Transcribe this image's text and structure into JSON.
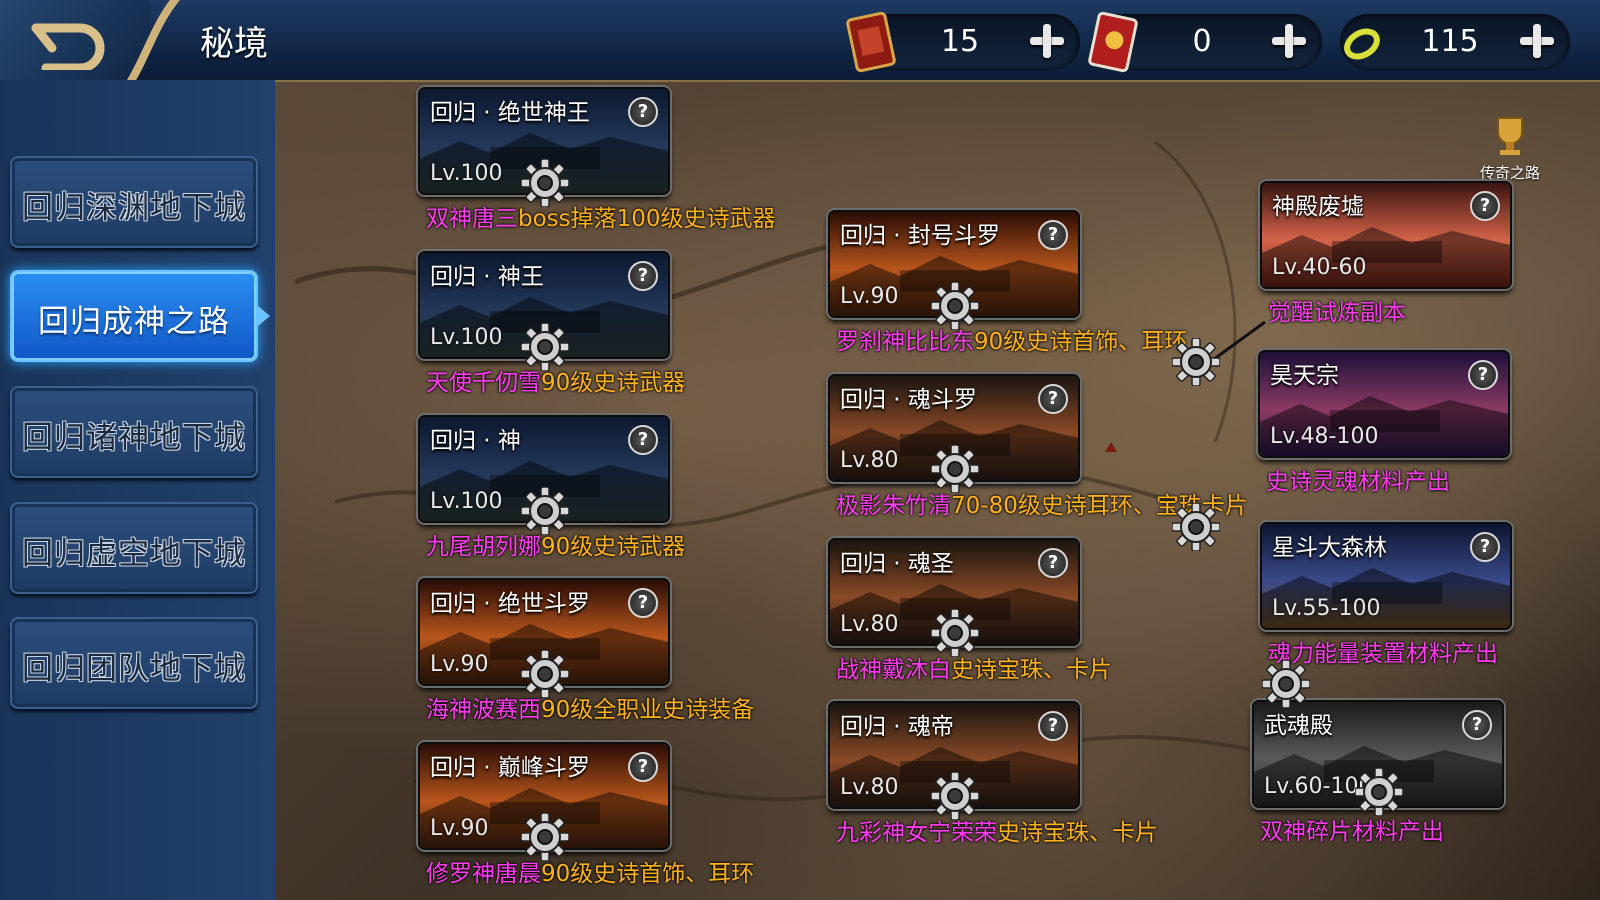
{
  "header": {
    "title": "秘境",
    "currencies": [
      {
        "icon": "red-ticket-book-icon",
        "value": "15"
      },
      {
        "icon": "red-scroll-book-icon",
        "value": "0"
      },
      {
        "icon": "gold-ring-coin-icon",
        "value": "115"
      }
    ]
  },
  "sidebar": {
    "items": [
      {
        "label": "回归深渊地下城",
        "active": false
      },
      {
        "label": "回归成神之路",
        "active": true
      },
      {
        "label": "回归诸神地下城",
        "active": false
      },
      {
        "label": "回归虚空地下城",
        "active": false
      },
      {
        "label": "回归团队地下城",
        "active": false
      }
    ]
  },
  "map": {
    "legend_label": "传奇之路",
    "dungeons": [
      {
        "name": "回归 · 绝世神王",
        "level": "Lv.100",
        "desc_magenta": "双神唐三",
        "desc_orange": "boss掉落100级史诗武器",
        "theme": "night"
      },
      {
        "name": "回归 · 神王",
        "level": "Lv.100",
        "desc_magenta": "天使千仞雪",
        "desc_orange": "90级史诗武器",
        "theme": "night"
      },
      {
        "name": "回归 · 神",
        "level": "Lv.100",
        "desc_magenta": "九尾胡列娜",
        "desc_orange": "90级史诗武器",
        "theme": "night"
      },
      {
        "name": "回归 · 绝世斗罗",
        "level": "Lv.90",
        "desc_magenta": "海神波赛西",
        "desc_orange": "90级全职业史诗装备",
        "theme": "fire"
      },
      {
        "name": "回归 · 巅峰斗罗",
        "level": "Lv.90",
        "desc_magenta": "修罗神唐晨",
        "desc_orange": "90级史诗首饰、耳环",
        "theme": "fire"
      },
      {
        "name": "回归 · 封号斗罗",
        "level": "Lv.90",
        "desc_magenta": "罗刹神比比东",
        "desc_orange": "90级史诗首饰、耳环",
        "theme": "fire"
      },
      {
        "name": "回归 · 魂斗罗",
        "level": "Lv.80",
        "desc_magenta": "极影朱竹清",
        "desc_orange": "70-80级史诗耳环、宝珠卡片",
        "theme": "dusk"
      },
      {
        "name": "回归 · 魂圣",
        "level": "Lv.80",
        "desc_magenta": "战神戴沐白",
        "desc_orange": "史诗宝珠、卡片",
        "theme": "dusk"
      },
      {
        "name": "回归 · 魂帝",
        "level": "Lv.80",
        "desc_magenta": "九彩神女宁荣荣",
        "desc_orange": "史诗宝珠、卡片",
        "theme": "dusk"
      },
      {
        "name": "神殿废墟",
        "level": "Lv.40-60",
        "desc_magenta": "觉醒试炼副本",
        "desc_orange": "",
        "theme": "ruins"
      },
      {
        "name": "昊天宗",
        "level": "Lv.48-100",
        "desc_magenta": "史诗灵魂材料产出",
        "desc_orange": "",
        "theme": "purple"
      },
      {
        "name": "星斗大森林",
        "level": "Lv.55-100",
        "desc_magenta": "魂力能量装置材料产出",
        "desc_orange": "",
        "theme": "forest"
      },
      {
        "name": "武魂殿",
        "level": "Lv.60-100",
        "desc_magenta": "双神碎片材料产出",
        "desc_orange": "",
        "theme": "warrior"
      }
    ]
  },
  "colors": {
    "magenta": "#ff3cf0",
    "orange": "#ffb21f",
    "active_blue": "#1d7fe6",
    "gold_trim": "#a88d5a"
  }
}
